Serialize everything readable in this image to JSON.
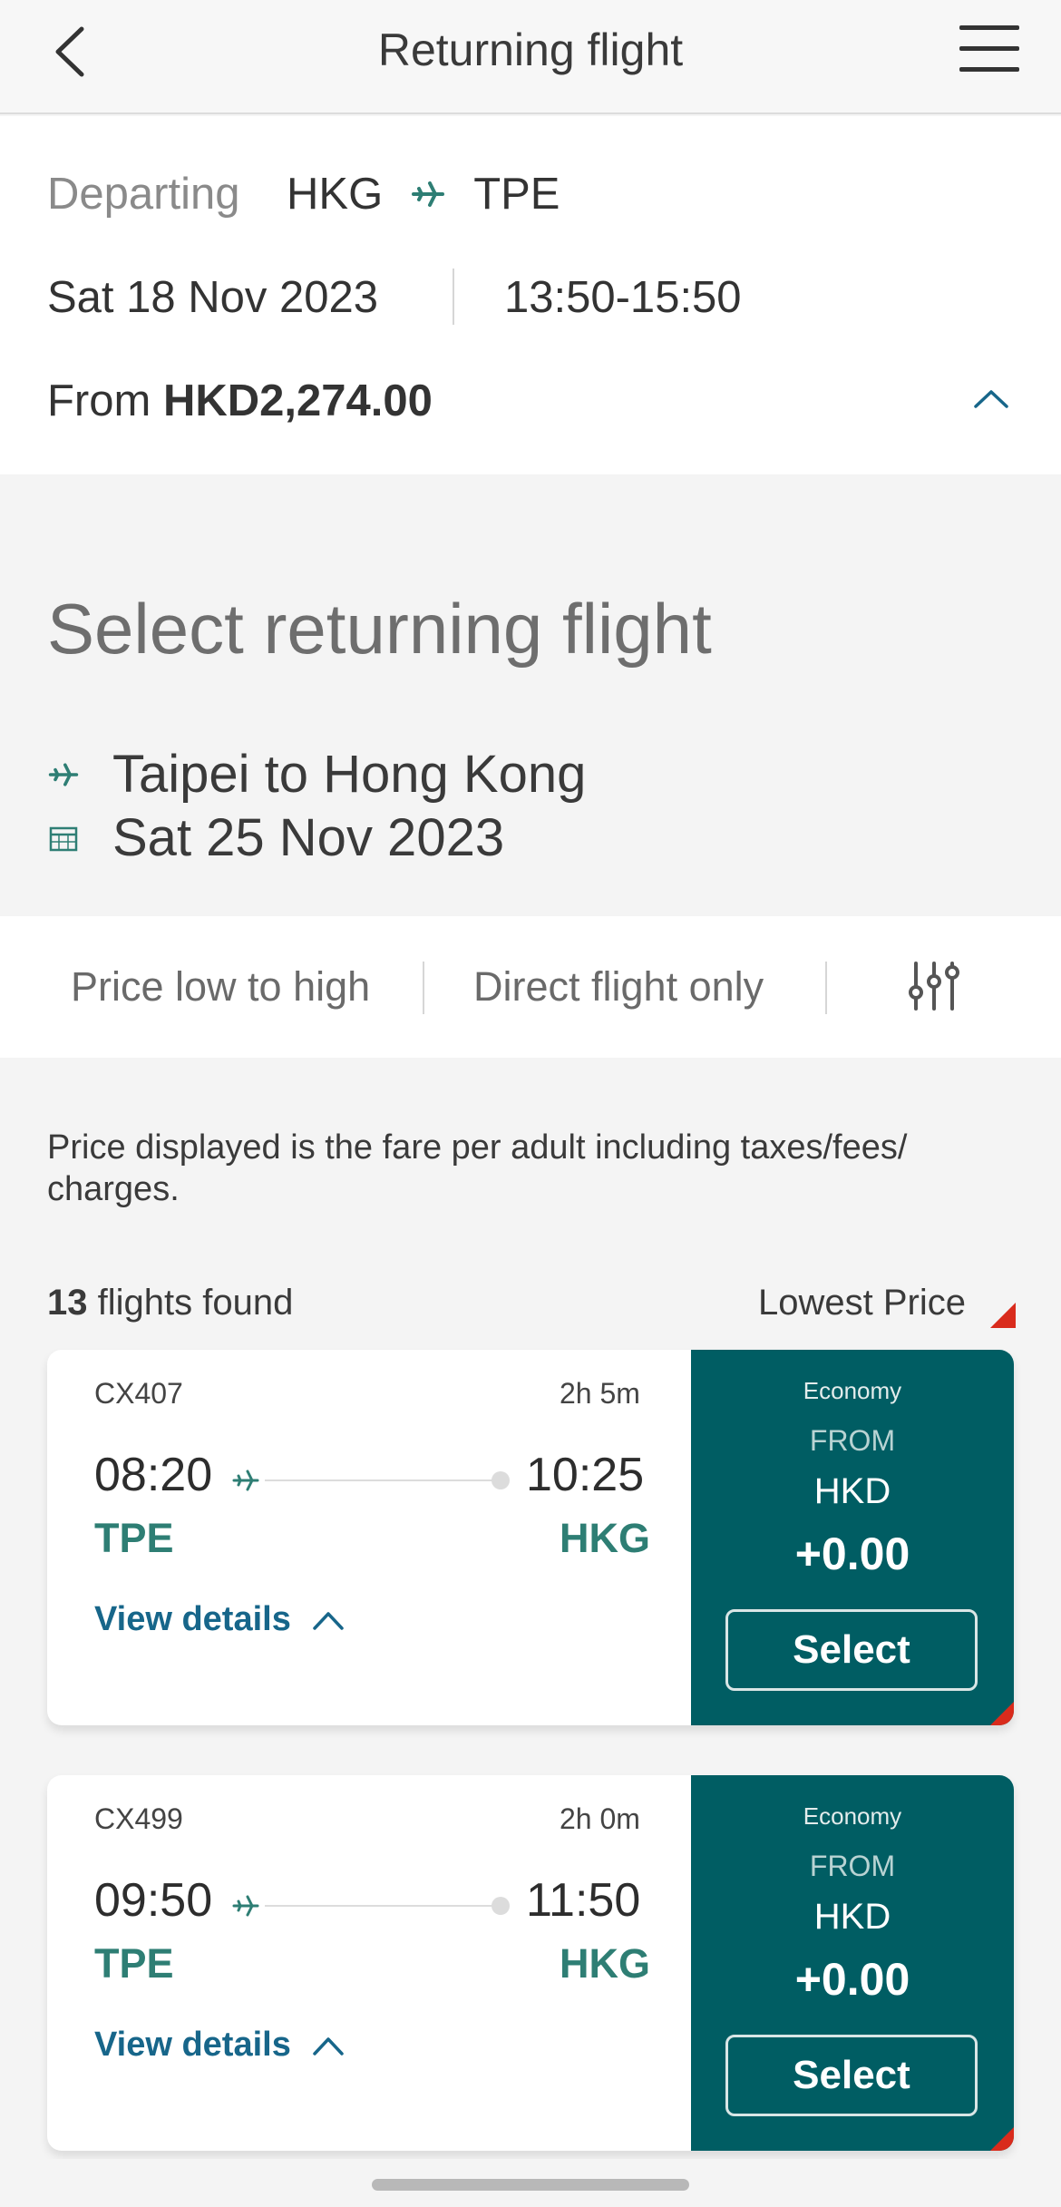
{
  "header": {
    "title": "Returning flight",
    "back_icon": "chevron-left-icon",
    "menu_icon": "hamburger-menu-icon"
  },
  "departing": {
    "label": "Departing",
    "origin": "HKG",
    "destination": "TPE",
    "date": "Sat 18 Nov 2023",
    "time": "13:50-15:50",
    "price_prefix": "From",
    "price": "HKD2,274.00"
  },
  "returning": {
    "section_title": "Select returning flight",
    "route": "Taipei to Hong Kong",
    "date": "Sat 25 Nov 2023"
  },
  "sort": {
    "price_label": "Price low to high",
    "direct_label": "Direct flight only",
    "filter_icon": "sliders-filter-icon"
  },
  "results": {
    "note": "Price displayed is the fare per adult including taxes/fees/ charges.",
    "count": "13",
    "count_suffix": " flights found",
    "sort_indicator": "Lowest Price"
  },
  "flights": [
    {
      "number": "CX407",
      "duration": "2h 5m",
      "depart_time": "08:20",
      "arrive_time": "10:25",
      "origin": "TPE",
      "destination": "HKG",
      "details_label": "View details",
      "cabin": "Economy",
      "from_label": "FROM",
      "currency": "HKD",
      "amount": "+0.00",
      "select_label": "Select"
    },
    {
      "number": "CX499",
      "duration": "2h 0m",
      "depart_time": "09:50",
      "arrive_time": "11:50",
      "origin": "TPE",
      "destination": "HKG",
      "details_label": "View details",
      "cabin": "Economy",
      "from_label": "FROM",
      "currency": "HKD",
      "amount": "+0.00",
      "select_label": "Select"
    }
  ],
  "colors": {
    "brand_teal": "#005d63",
    "text_teal": "#2e7e74",
    "link_blue": "#17668a",
    "accent_red": "#d92b1c"
  }
}
